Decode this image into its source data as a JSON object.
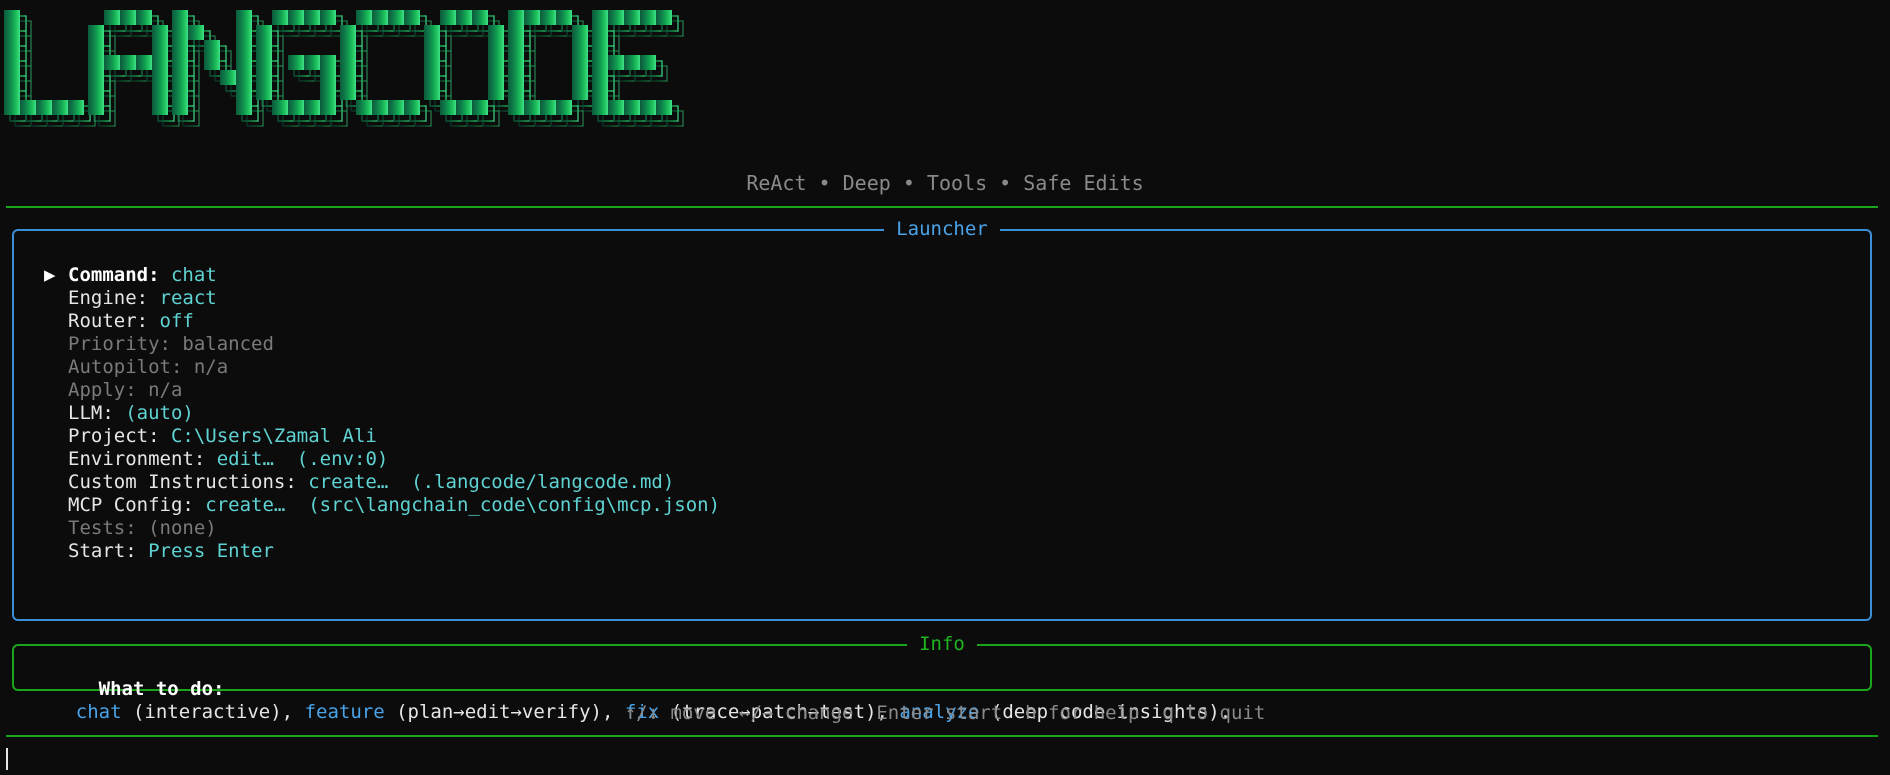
{
  "banner": {
    "title": "LANGCODE",
    "gradient": [
      "#0b5c3a",
      "#0f7a4a",
      "#10a050",
      "#22c55e",
      "#3ee08c"
    ]
  },
  "subtitle": "ReAct • Deep • Tools • Safe Edits",
  "launcher": {
    "title": "Launcher",
    "items": [
      {
        "key": "Command:",
        "value": "chat",
        "selected": true,
        "dim": false
      },
      {
        "key": "Engine:",
        "value": "react",
        "selected": false,
        "dim": false
      },
      {
        "key": "Router:",
        "value": "off",
        "selected": false,
        "dim": false
      },
      {
        "key": "Priority:",
        "value": "balanced",
        "selected": false,
        "dim": true
      },
      {
        "key": "Autopilot:",
        "value": "n/a",
        "selected": false,
        "dim": true
      },
      {
        "key": "Apply:",
        "value": "n/a",
        "selected": false,
        "dim": true
      },
      {
        "key": "LLM:",
        "value": "(auto)",
        "selected": false,
        "dim": false
      },
      {
        "key": "Project:",
        "value": "C:\\Users\\Zamal Ali",
        "selected": false,
        "dim": false
      },
      {
        "key": "Environment:",
        "value": "edit…  (.env:0)",
        "selected": false,
        "dim": false
      },
      {
        "key": "Custom Instructions:",
        "value": "create…  (.langcode/langcode.md)",
        "selected": false,
        "dim": false
      },
      {
        "key": "MCP Config:",
        "value": "create…  (src\\langchain_code\\config\\mcp.json)",
        "selected": false,
        "dim": false
      },
      {
        "key": "Tests:",
        "value": "(none)",
        "selected": false,
        "dim": true
      },
      {
        "key": "Start:",
        "value": "Press Enter",
        "selected": false,
        "dim": false
      }
    ],
    "cursor_glyph": "▶"
  },
  "info": {
    "title": "Info",
    "lead": "What to do:",
    "entries": [
      {
        "cmd": "chat",
        "desc": " (interactive), "
      },
      {
        "cmd": "feature",
        "desc": " (plan→edit→verify), "
      },
      {
        "cmd": "fix",
        "desc": " (trace→patch→test), "
      },
      {
        "cmd": "analyze",
        "desc": " (deep code insights)."
      }
    ]
  },
  "hints": "↑/↓ move  ←/→ change  Enter start  h for help  q to quit",
  "colors": {
    "background": "#0c0c0c",
    "accent_green": "#1aa51a",
    "accent_blue": "#3a8fd6",
    "value_cyan": "#5fd3d3"
  }
}
